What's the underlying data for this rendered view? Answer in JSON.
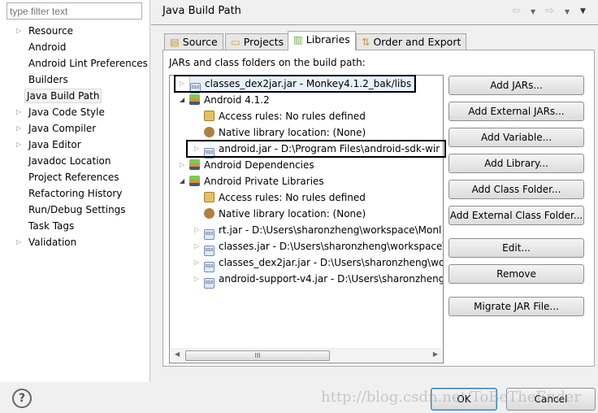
{
  "filter": {
    "placeholder": "type filter text"
  },
  "sidebar": {
    "items": [
      {
        "label": "Resource",
        "expandable": true
      },
      {
        "label": "Android",
        "expandable": false
      },
      {
        "label": "Android Lint Preferences",
        "expandable": false
      },
      {
        "label": "Builders",
        "expandable": false
      },
      {
        "label": "Java Build Path",
        "expandable": false,
        "selected": true
      },
      {
        "label": "Java Code Style",
        "expandable": true
      },
      {
        "label": "Java Compiler",
        "expandable": true
      },
      {
        "label": "Java Editor",
        "expandable": true
      },
      {
        "label": "Javadoc Location",
        "expandable": false
      },
      {
        "label": "Project References",
        "expandable": false
      },
      {
        "label": "Refactoring History",
        "expandable": false
      },
      {
        "label": "Run/Debug Settings",
        "expandable": false
      },
      {
        "label": "Task Tags",
        "expandable": false
      },
      {
        "label": "Validation",
        "expandable": true
      }
    ]
  },
  "header": {
    "title": "Java Build Path",
    "back_icon": "arrow-left-icon",
    "forward_icon": "arrow-right-icon",
    "menu_icon": "chevron-down-icon"
  },
  "tabs": [
    {
      "label": "Source"
    },
    {
      "label": "Projects"
    },
    {
      "label": "Libraries",
      "active": true
    },
    {
      "label": "Order and Export"
    }
  ],
  "libraries": {
    "label": "JARs and class folders on the build path:",
    "tree": [
      {
        "label": "classes_dex2jar.jar - Monkey4.1.2_bak/libs",
        "level": 0,
        "icon": "jar",
        "toggle": "collapsed",
        "selected": true,
        "highlighted": true
      },
      {
        "label": "Android 4.1.2",
        "level": 0,
        "icon": "library",
        "toggle": "expanded"
      },
      {
        "label": "Access rules: No rules defined",
        "level": 1,
        "icon": "access-rules",
        "toggle": "none"
      },
      {
        "label": "Native library location: (None)",
        "level": 1,
        "icon": "native-library",
        "toggle": "none"
      },
      {
        "label": "android.jar - D:\\Program Files\\android-sdk-wir",
        "level": 1,
        "icon": "jar",
        "toggle": "collapsed",
        "highlighted": true
      },
      {
        "label": "Android Dependencies",
        "level": 0,
        "icon": "library",
        "toggle": "collapsed"
      },
      {
        "label": "Android Private Libraries",
        "level": 0,
        "icon": "library",
        "toggle": "expanded"
      },
      {
        "label": "Access rules: No rules defined",
        "level": 1,
        "icon": "access-rules",
        "toggle": "none"
      },
      {
        "label": "Native library location: (None)",
        "level": 1,
        "icon": "native-library",
        "toggle": "none"
      },
      {
        "label": "rt.jar - D:\\Users\\sharonzheng\\workspace\\Monl",
        "level": 1,
        "icon": "jar",
        "toggle": "collapsed"
      },
      {
        "label": "classes.jar - D:\\Users\\sharonzheng\\workspace\\",
        "level": 1,
        "icon": "jar",
        "toggle": "collapsed"
      },
      {
        "label": "classes_dex2jar.jar - D:\\Users\\sharonzheng\\wo",
        "level": 1,
        "icon": "jar",
        "toggle": "collapsed"
      },
      {
        "label": "android-support-v4.jar - D:\\Users\\sharonzheng",
        "level": 1,
        "icon": "jar",
        "toggle": "collapsed"
      }
    ],
    "scroll_thumb": "III",
    "buttons": [
      "Add JARs...",
      "Add External JARs...",
      "Add Variable...",
      "Add Library...",
      "Add Class Folder...",
      "Add External Class Folder...",
      "Edit...",
      "Remove",
      "Migrate JAR File..."
    ]
  },
  "footer": {
    "help_icon": "?",
    "ok": "OK",
    "cancel": "Cancel",
    "watermark": "http://blog.csdn.net/ToBeTheEnder"
  }
}
